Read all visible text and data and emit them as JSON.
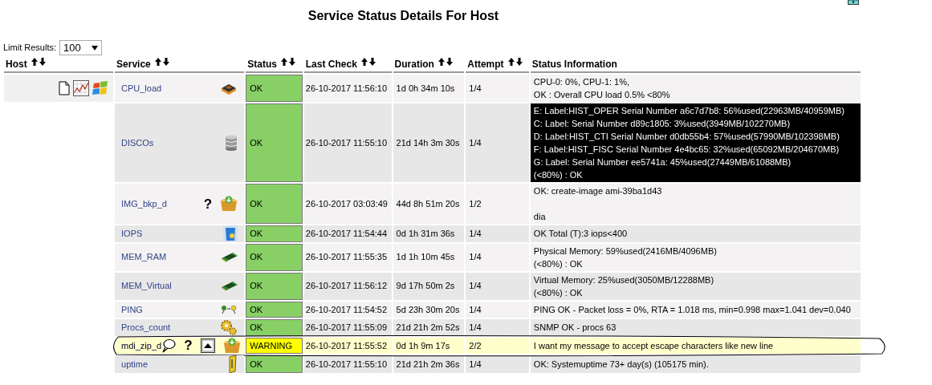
{
  "title": "Service Status Details For Host",
  "limit": {
    "label": "Limit Results:",
    "value": "100"
  },
  "columns": [
    {
      "label": "Host",
      "sortable": true
    },
    {
      "label": "Service",
      "sortable": true
    },
    {
      "label": "Status",
      "sortable": true
    },
    {
      "label": "Last Check",
      "sortable": true
    },
    {
      "label": "Duration",
      "sortable": true
    },
    {
      "label": "Attempt",
      "sortable": true
    },
    {
      "label": "Status Information",
      "sortable": false
    }
  ],
  "host": {
    "icons": [
      {
        "kind": "document"
      },
      {
        "kind": "graph"
      },
      {
        "kind": "windows"
      }
    ]
  },
  "rows": [
    {
      "service": "CPU_load",
      "icons": [
        {
          "kind": "chip"
        }
      ],
      "status": "OK",
      "kind": "ok",
      "last_check": "26-10-2017 11:56:10",
      "duration": "1d 0h 34m 10s",
      "attempt": "1/4",
      "circled": false,
      "info": {
        "kind": "plain",
        "paragraphs": [
          [
            "CPU-0: 0%, CPU-1: 1%,",
            "OK : Overall CPU load 0.5% <80%"
          ]
        ]
      }
    },
    {
      "service": "DISCOs",
      "icons": [
        {
          "kind": "database"
        }
      ],
      "status": "OK",
      "kind": "ok",
      "last_check": "26-10-2017 11:55:10",
      "duration": "21d 14h 3m 30s",
      "attempt": "1/4",
      "circled": false,
      "info": {
        "kind": "dark",
        "paragraphs": [
          [
            "E: Label:HIST_OPER Serial Number a6c7d7b8: 56%used(22963MB/40959MB)",
            "C: Label: Serial Number d89c1805: 3%used(3949MB/102270MB)",
            "D: Label:HIST_CTI Serial Number d0db55b4: 57%used(57990MB/102398MB)",
            "F: Label:HIST_FISC Serial Number 4e4bc65: 32%used(65092MB/204670MB)",
            "G: Label: Serial Number ee5741a: 45%used(27449MB/61088MB)",
            "(<80%) : OK"
          ]
        ]
      }
    },
    {
      "service": "IMG_bkp_d",
      "icons": [
        {
          "kind": "text",
          "text": "?"
        },
        {
          "kind": "package"
        }
      ],
      "status": "OK",
      "kind": "ok",
      "last_check": "26-10-2017 03:03:49",
      "duration": "44d 8h 51m 20s",
      "attempt": "1/2",
      "circled": false,
      "info": {
        "kind": "plain",
        "paragraphs": [
          [
            "OK: create-image ami-39ba1d43"
          ],
          [
            "dia"
          ]
        ]
      }
    },
    {
      "service": "IOPS",
      "icons": [
        {
          "kind": "bin"
        }
      ],
      "status": "OK",
      "kind": "ok",
      "last_check": "26-10-2017 11:54:44",
      "duration": "0d 1h 31m 36s",
      "attempt": "1/4",
      "circled": false,
      "info": {
        "kind": "plain",
        "paragraphs": [
          [
            "OK Total (T):3 iops<400"
          ]
        ]
      }
    },
    {
      "service": "MEM_RAM",
      "icons": [
        {
          "kind": "ram"
        }
      ],
      "status": "OK",
      "kind": "ok",
      "last_check": "26-10-2017 11:55:35",
      "duration": "1d 1h 10m 45s",
      "attempt": "1/4",
      "circled": false,
      "info": {
        "kind": "plain",
        "paragraphs": [
          [
            "Physical Memory: 59%used(2416MB/4096MB)",
            "(<80%) : OK"
          ]
        ]
      }
    },
    {
      "service": "MEM_Virtual",
      "icons": [
        {
          "kind": "ram"
        }
      ],
      "status": "OK",
      "kind": "ok",
      "last_check": "26-10-2017 11:56:12",
      "duration": "9d 17h 50m 2s",
      "attempt": "1/4",
      "circled": false,
      "info": {
        "kind": "plain",
        "paragraphs": [
          [
            "Virtual Memory: 25%used(3050MB/12288MB)",
            "(<80%) : OK"
          ]
        ]
      }
    },
    {
      "service": "PING",
      "icons": [
        {
          "kind": "ping"
        }
      ],
      "status": "OK",
      "kind": "ok",
      "last_check": "26-10-2017 11:54:52",
      "duration": "5d 23h 30m 20s",
      "attempt": "1/4",
      "circled": false,
      "info": {
        "kind": "plain",
        "paragraphs": [
          [
            "PING OK - Packet loss = 0%, RTA = 1.018 ms, min=0.998 max=1.041 dev=0.040"
          ]
        ]
      }
    },
    {
      "service": "Procs_count",
      "icons": [
        {
          "kind": "gears"
        }
      ],
      "status": "OK",
      "kind": "ok",
      "last_check": "26-10-2017 11:55:09",
      "duration": "21d 21h 2m 52s",
      "attempt": "1/4",
      "circled": false,
      "info": {
        "kind": "plain",
        "paragraphs": [
          [
            "SNMP OK - procs 63"
          ]
        ]
      }
    },
    {
      "service": "mdi_zip_d",
      "icons": [
        {
          "kind": "comment"
        },
        {
          "kind": "text",
          "text": "?"
        },
        {
          "kind": "ack"
        },
        {
          "kind": "package"
        }
      ],
      "status": "WARNING",
      "kind": "warning",
      "last_check": "26-10-2017 11:55:52",
      "duration": "0d 1h 9m 17s",
      "attempt": "2/2",
      "circled": true,
      "info": {
        "kind": "plain",
        "paragraphs": [
          [
            "I want my message to accept escape characters like new line"
          ]
        ]
      }
    },
    {
      "service": "uptime",
      "icons": [
        {
          "kind": "clock"
        }
      ],
      "status": "OK",
      "kind": "ok",
      "last_check": "26-10-2017 11:55:10",
      "duration": "21d 21h 2m 36s",
      "attempt": "1/4",
      "circled": false,
      "info": {
        "kind": "plain",
        "paragraphs": [
          [
            "OK: Systemuptime 73+ day(s) (105175 min)."
          ]
        ]
      }
    }
  ]
}
